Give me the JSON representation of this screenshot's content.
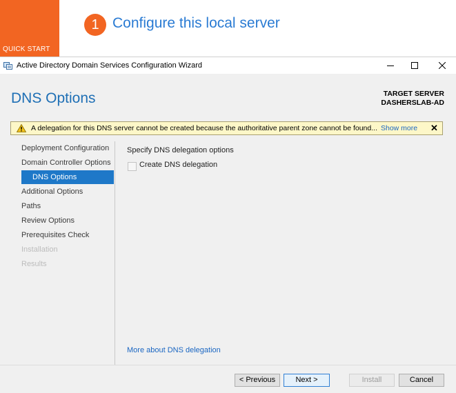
{
  "background": {
    "quick_start_label": "QUICK START",
    "step_number": "1",
    "step_title": "Configure this local server"
  },
  "window": {
    "title": "Active Directory Domain Services Configuration Wizard",
    "icon": "ad-wizard-icon"
  },
  "page": {
    "heading": "DNS Options",
    "target_server_label": "TARGET SERVER",
    "target_server_name": "DASHERSLAB-AD"
  },
  "warning": {
    "text": "A delegation for this DNS server cannot be created because the authoritative parent zone cannot be found...",
    "show_more": "Show more",
    "close": "✕"
  },
  "nav": {
    "items": [
      {
        "label": "Deployment Configuration",
        "state": "normal"
      },
      {
        "label": "Domain Controller Options",
        "state": "normal"
      },
      {
        "label": "DNS Options",
        "state": "active"
      },
      {
        "label": "Additional Options",
        "state": "normal"
      },
      {
        "label": "Paths",
        "state": "normal"
      },
      {
        "label": "Review Options",
        "state": "normal"
      },
      {
        "label": "Prerequisites Check",
        "state": "normal"
      },
      {
        "label": "Installation",
        "state": "disabled"
      },
      {
        "label": "Results",
        "state": "disabled"
      }
    ]
  },
  "main": {
    "section_label": "Specify DNS delegation options",
    "checkbox_label": "Create DNS delegation",
    "checkbox_checked": false,
    "more_link": "More about DNS delegation"
  },
  "footer": {
    "previous": "< Previous",
    "next": "Next >",
    "install": "Install",
    "cancel": "Cancel"
  },
  "colors": {
    "accent_orange": "#f26522",
    "heading_blue": "#1e6fb5",
    "nav_active": "#1e78c8",
    "warning_bg": "#fdf7c8"
  }
}
